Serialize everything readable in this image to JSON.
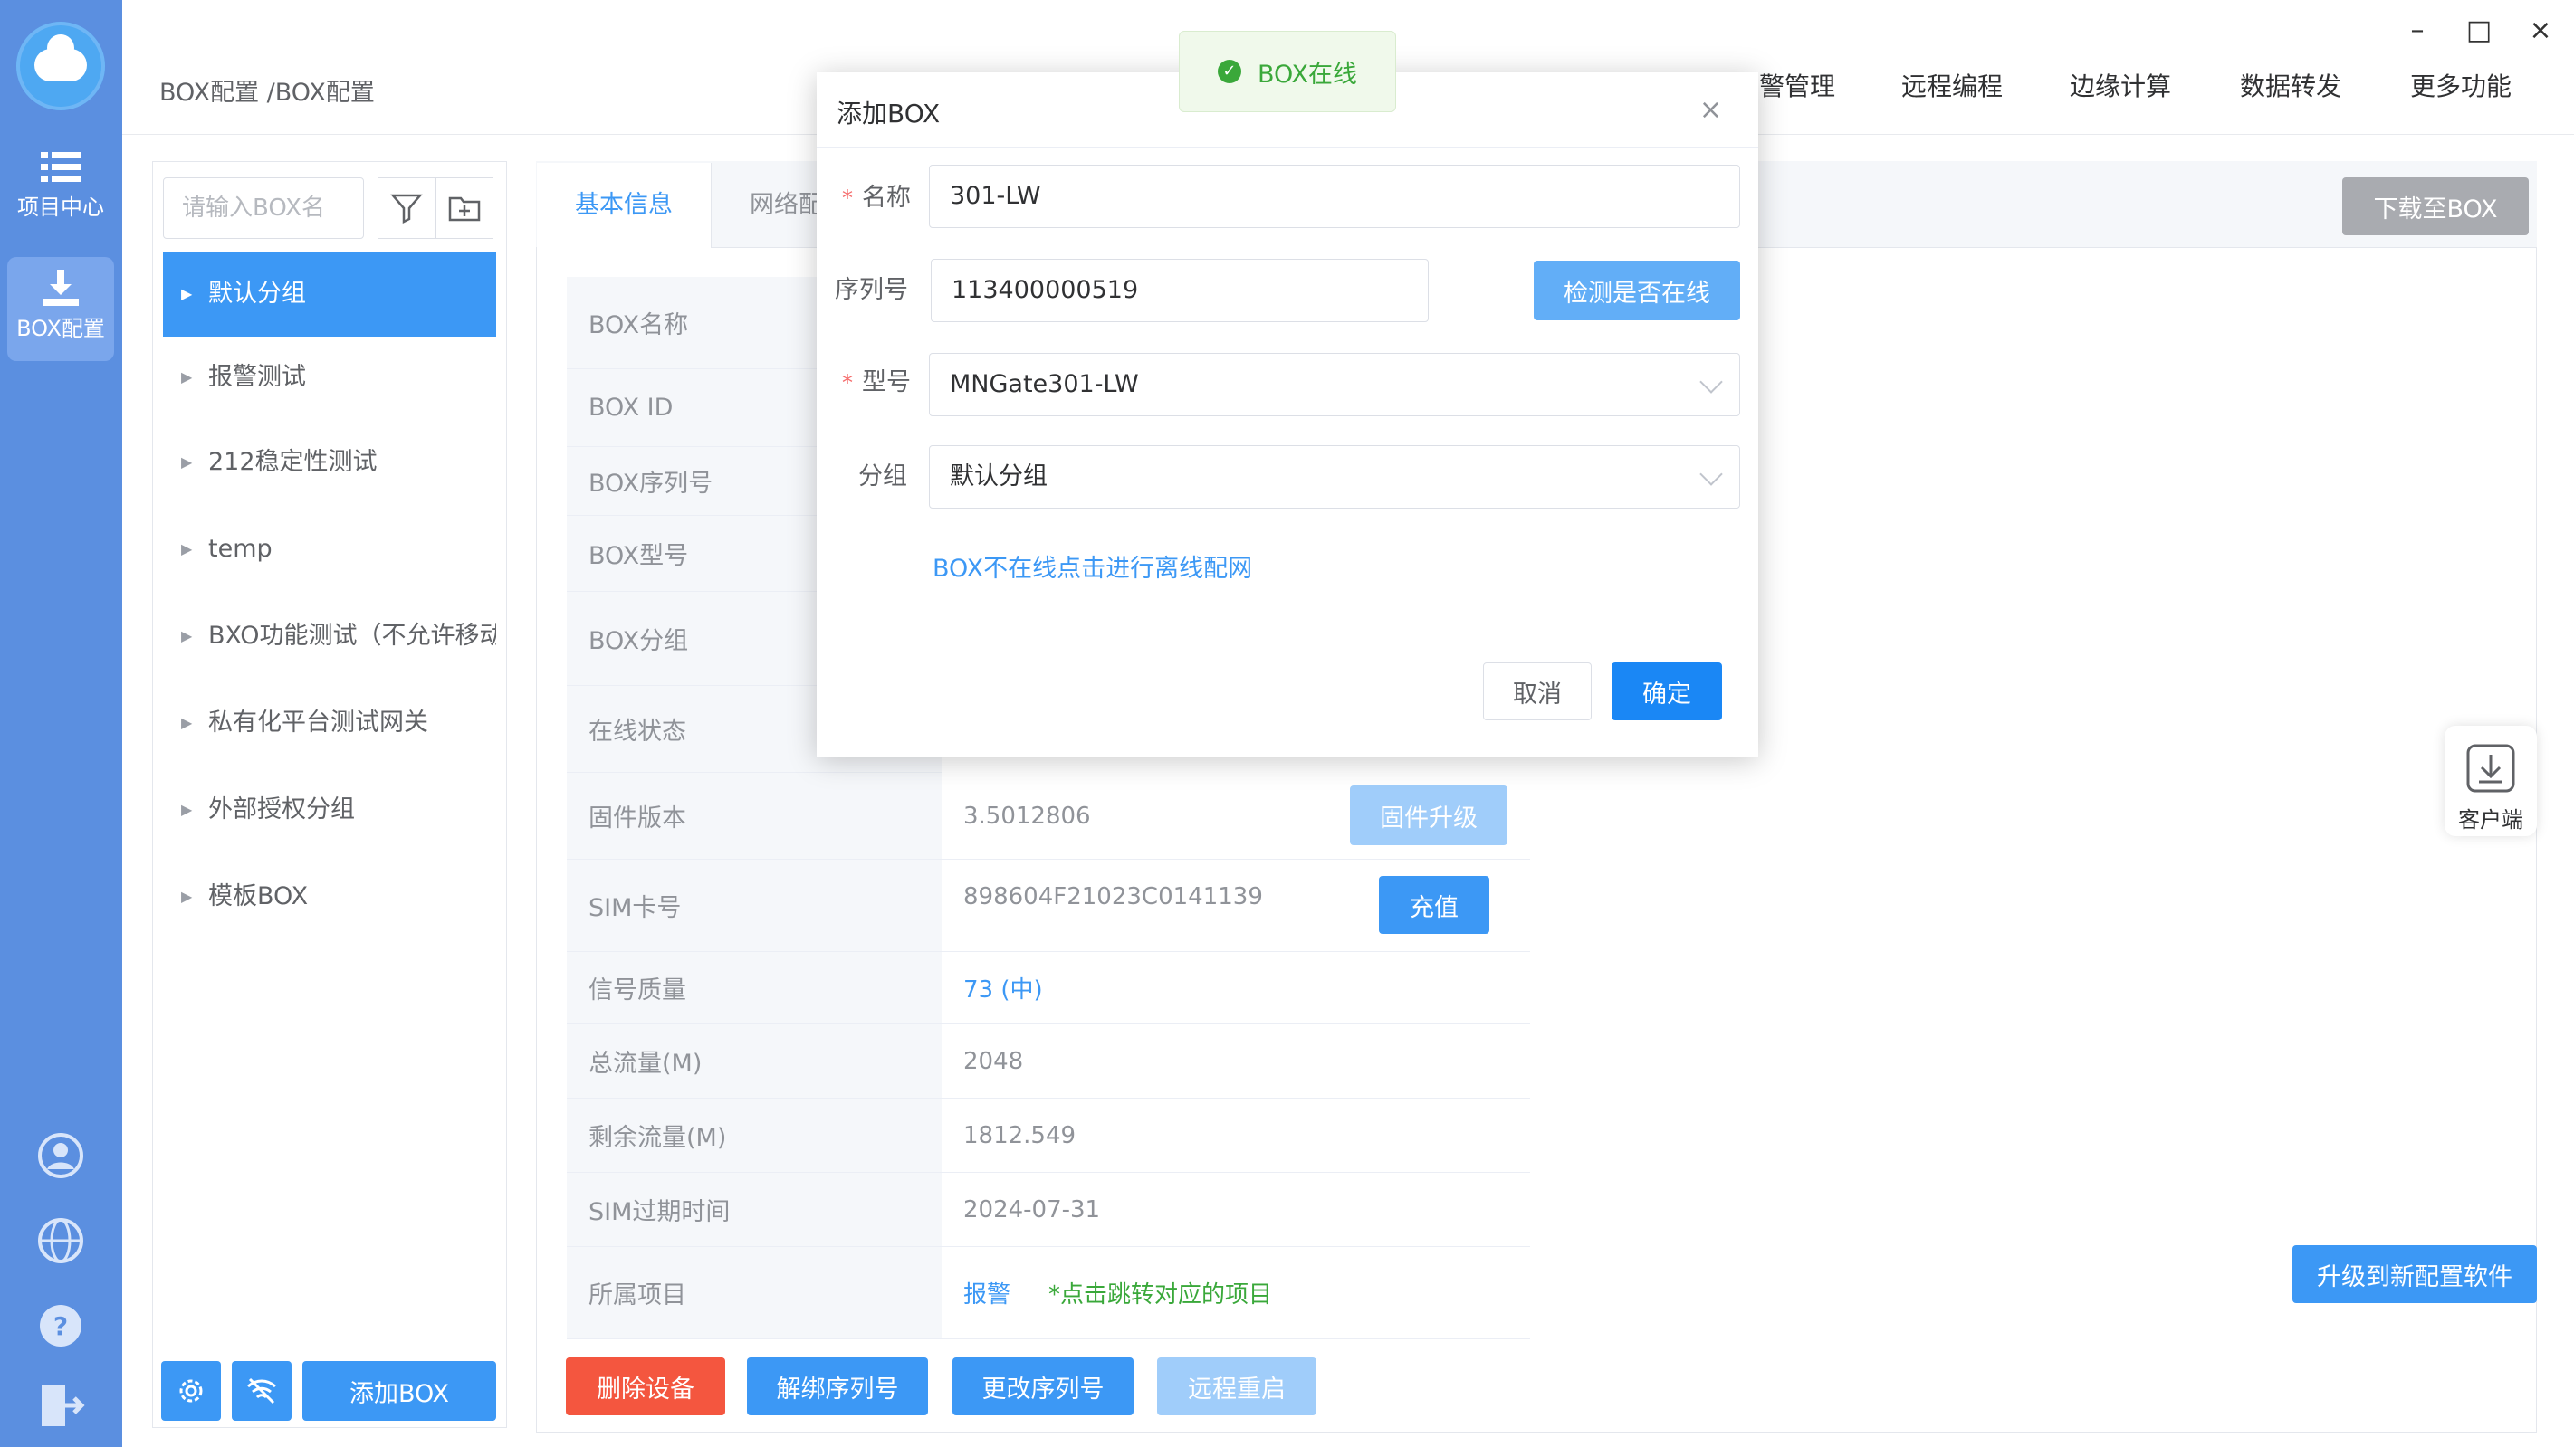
{
  "colors": {
    "rail": "#5b8fe0",
    "primary": "#3c98f5",
    "danger": "#f4563f",
    "success": "#3aa83a"
  },
  "rail": {
    "items": [
      {
        "label": "项目中心",
        "icon": "list-icon"
      },
      {
        "label": "BOX配置",
        "icon": "download-icon"
      }
    ],
    "bottom_icons": [
      "user-icon",
      "globe-icon",
      "help-icon",
      "exit-icon"
    ]
  },
  "header": {
    "breadcrumb": "BOX配置 /BOX配置",
    "nav": [
      "报警管理",
      "远程编程",
      "边缘计算",
      "数据转发",
      "更多功能"
    ]
  },
  "groups": {
    "search_placeholder": "请输入BOX名称",
    "items": [
      "默认分组",
      "报警测试",
      "212稳定性测试",
      "temp",
      "BXO功能测试（不允许移动）",
      "私有化平台测试网关",
      "外部授权分组",
      "模板BOX"
    ],
    "add_button": "添加BOX"
  },
  "detail": {
    "tabs": [
      "基本信息",
      "网络配置"
    ],
    "download_button": "下载至BOX",
    "labels": [
      "BOX名称",
      "BOX ID",
      "BOX序列号",
      "BOX型号",
      "BOX分组",
      "在线状态",
      "固件版本",
      "SIM卡号",
      "信号质量",
      "总流量(M)",
      "剩余流量(M)",
      "SIM过期时间",
      "所属项目"
    ],
    "firmware_version": "3.5012806",
    "firmware_button": "固件升级",
    "sim_number": "898604F21023C0141139",
    "recharge_button": "充值",
    "signal": "73 (中)",
    "total_traffic": "2048",
    "remaining_traffic": "1812.549",
    "sim_expiry": "2024-07-31",
    "project_link": "报警",
    "project_hint": "*点击跳转对应的项目",
    "actions": [
      "删除设备",
      "解绑序列号",
      "更改序列号",
      "远程重启"
    ],
    "upgrade_button": "升级到新配置软件",
    "client_label": "客户端"
  },
  "toast": {
    "text": "BOX在线"
  },
  "dialog": {
    "title": "添加BOX",
    "name_label": "名称",
    "name_value": "301-LW",
    "serial_label": "序列号",
    "serial_value": "113400000519",
    "check_button": "检测是否在线",
    "model_label": "型号",
    "model_value": "MNGate301-LW",
    "group_label": "分组",
    "group_value": "默认分组",
    "offline_link": "BOX不在线点击进行离线配网",
    "cancel": "取消",
    "confirm": "确定"
  }
}
